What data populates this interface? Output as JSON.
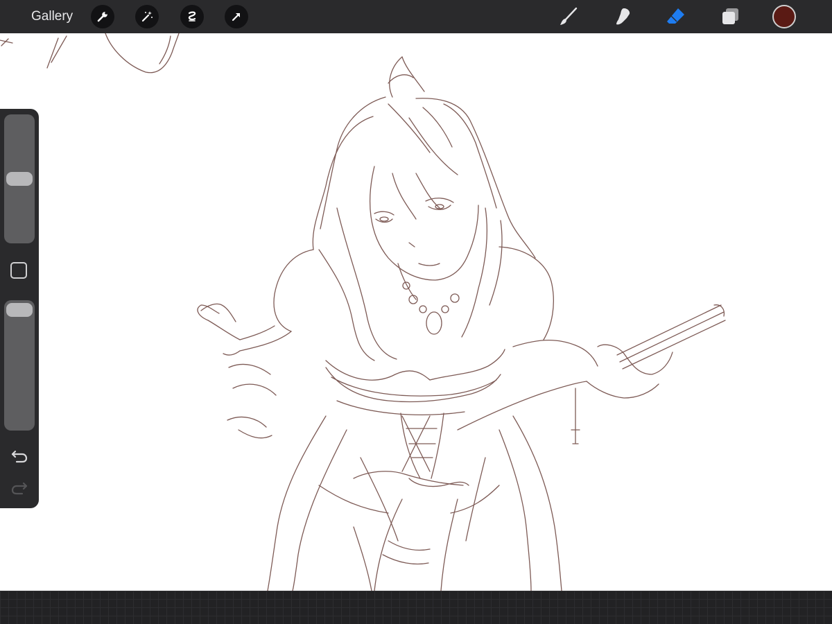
{
  "topbar": {
    "gallery_label": "Gallery",
    "left_tools": [
      "wrench-icon",
      "magic-wand-icon",
      "selection-icon",
      "transform-arrow-icon"
    ],
    "right_tools": [
      "brush-icon",
      "smudge-icon",
      "eraser-icon",
      "layers-icon"
    ],
    "active_tool": "eraser",
    "current_color": "#5a1a14",
    "active_tool_color": "#1e7cf0"
  },
  "sidebar": {
    "brush_size_level": 0.5,
    "opacity_level": 1.0,
    "icons": [
      "modify-square-icon",
      "undo-icon",
      "redo-icon"
    ]
  },
  "canvas": {
    "sketch_stroke_color": "#7d5a55"
  }
}
